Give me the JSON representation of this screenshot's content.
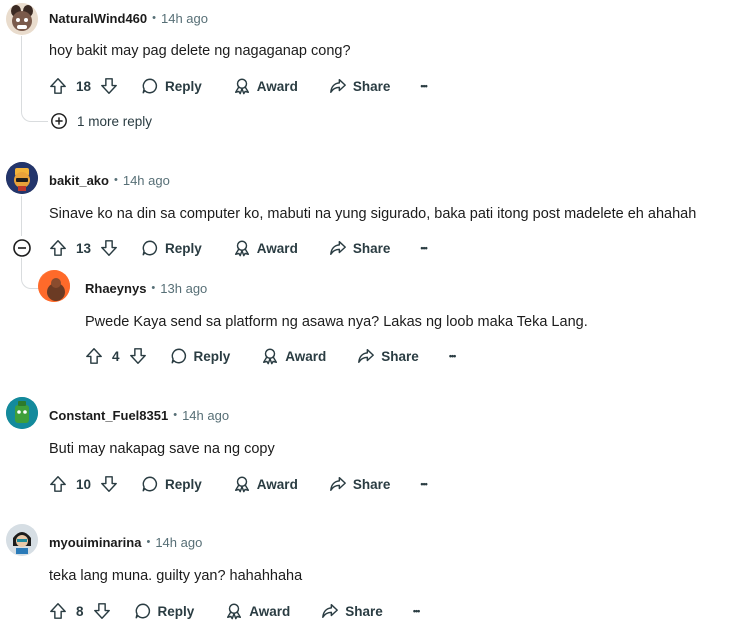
{
  "comments": [
    {
      "username": "NaturalWind460",
      "time": "14h ago",
      "text": "hoy bakit may pag delete ng nagaganap cong?",
      "votes": "18",
      "more_replies": "1 more reply"
    },
    {
      "username": "bakit_ako",
      "time": "14h ago",
      "text": "Sinave ko na din sa computer ko, mabuti na yung sigurado, baka pati itong post madelete eh ahahah",
      "votes": "13"
    },
    {
      "username": "Rhaeynys",
      "time": "13h ago",
      "text": "Pwede Kaya send sa platform ng asawa nya? Lakas ng loob maka Teka Lang.",
      "votes": "4"
    },
    {
      "username": "Constant_Fuel8351",
      "time": "14h ago",
      "text": "Buti may nakapag save na ng copy",
      "votes": "10"
    },
    {
      "username": "myouiminarina",
      "time": "14h ago",
      "text": "teka lang muna. guilty yan? hahahhaha",
      "votes": "8"
    }
  ],
  "labels": {
    "separator": "•",
    "reply": "Reply",
    "award": "Award",
    "share": "Share",
    "more": "•••"
  },
  "icons": {
    "upvote": "arrow-up-outline",
    "downvote": "arrow-down-outline",
    "reply": "speech-bubble",
    "award": "award-ribbon",
    "share": "share-arrow",
    "overflow": "ellipsis",
    "expand": "plus-circle",
    "collapse": "minus-circle"
  },
  "colors": {
    "text": "#1c1c1c",
    "meta": "#576f76",
    "action": "#2a3c42",
    "thread_line": "#d9dcde"
  }
}
